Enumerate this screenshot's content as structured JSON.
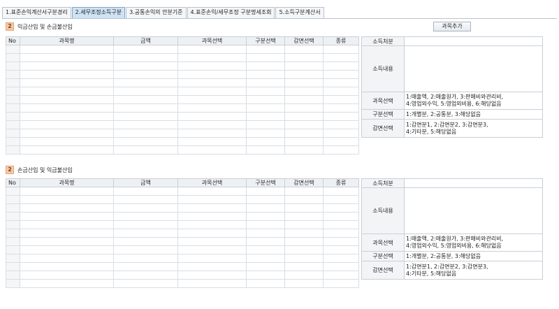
{
  "tabs": [
    {
      "label": "1.표준손익계산서구분경리",
      "active": false
    },
    {
      "label": "2.세무조정소득구분",
      "active": true
    },
    {
      "label": "3.공통손익의 안분기준",
      "active": false
    },
    {
      "label": "4.표준손익/세무조정 구분명세조회",
      "active": false
    },
    {
      "label": "5.소득구분계산서",
      "active": false
    }
  ],
  "add_button": "과목추가",
  "grid_columns": [
    "No",
    "과목명",
    "금액",
    "과목선택",
    "구분선택",
    "감면선택",
    "종류"
  ],
  "sections": [
    {
      "num": "2",
      "title": "익금산입 및 손금불산입",
      "info": {
        "income_disposition": "소득처분",
        "income_content": "소득내용",
        "account_select": "과목선택",
        "account_options_1": "1:매출액, 2:매출원가, 3:판매비와관리비,",
        "account_options_2": "4:영업외수익, 5:영업외비용, 6:해당없음",
        "type_select": "구분선택",
        "type_options": "1:개별분, 2:공통분, 3:해당없음",
        "reduction_select": "감면선택",
        "reduction_options_1": "1:감면분1, 2:감면분2, 3:감면분3,",
        "reduction_options_2": "4:기타분, 5:해당없음"
      }
    },
    {
      "num": "2",
      "title": "손금산입 및 익금불산입",
      "info": {
        "income_disposition": "소득처분",
        "income_content": "소득내용",
        "account_select": "과목선택",
        "account_options_1": "1:매출액, 2:매출원가, 3:판매비와관리비,",
        "account_options_2": "4:영업외수익, 5:영업외비용, 6:해당없음",
        "type_select": "구분선택",
        "type_options": "1:개별분, 2:공통분, 3:해당없음",
        "reduction_select": "감면선택",
        "reduction_options_1": "1:감면분1, 2:감면분2, 3:감면분3,",
        "reduction_options_2": "4:기타분, 5:해당없음"
      }
    }
  ]
}
